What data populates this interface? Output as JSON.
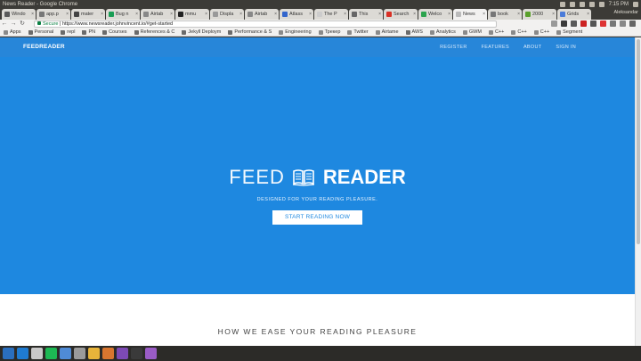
{
  "window": {
    "title": "News Reader - Google Chrome",
    "clock": "7:15 PM",
    "profile": "Aleksandar"
  },
  "tabs": [
    {
      "label": "Windo",
      "color": "#5a5a5a"
    },
    {
      "label": "app.p",
      "color": "#777777"
    },
    {
      "label": "mater",
      "color": "#444444"
    },
    {
      "label": "Bug n",
      "color": "#1a9e55"
    },
    {
      "label": "Airtab",
      "color": "#888888"
    },
    {
      "label": "mmu",
      "color": "#222222"
    },
    {
      "label": "Displa",
      "color": "#999999"
    },
    {
      "label": "Airtab",
      "color": "#888888"
    },
    {
      "label": "Atlass",
      "color": "#3366cc"
    },
    {
      "label": "The P",
      "color": "#cccccc"
    },
    {
      "label": "This",
      "color": "#666666"
    },
    {
      "label": "Search",
      "color": "#d93025"
    },
    {
      "label": "Welco",
      "color": "#2da44e"
    },
    {
      "label": "News",
      "color": "#bbbbbb",
      "active": true
    },
    {
      "label": "book",
      "color": "#777777"
    },
    {
      "label": "2000",
      "color": "#5aa02c"
    },
    {
      "label": "Grids",
      "color": "#4a7bd9"
    }
  ],
  "address": {
    "secure_label": "Secure",
    "url": "https://www.newsreader.johnvincent.io/#get-started"
  },
  "bookmarks": [
    {
      "label": "Apps",
      "icon": "apps-grid-icon"
    },
    {
      "label": "Personal",
      "icon": "folder-icon"
    },
    {
      "label": "repl",
      "icon": "folder-icon"
    },
    {
      "label": "PN",
      "icon": "folder-icon"
    },
    {
      "label": "Courses",
      "icon": "folder-icon"
    },
    {
      "label": "References & C",
      "icon": "folder-icon"
    },
    {
      "label": "Jekyll Deploym",
      "icon": "folder-icon"
    },
    {
      "label": "Performance & S",
      "icon": "folder-icon"
    },
    {
      "label": "Engineering",
      "icon": "link-icon"
    },
    {
      "label": "Трекер",
      "icon": "link-icon"
    },
    {
      "label": "Twitter",
      "icon": "twitter-icon"
    },
    {
      "label": "Airtame",
      "icon": "link-icon"
    },
    {
      "label": "AWS",
      "icon": "folder-icon"
    },
    {
      "label": "Analytics",
      "icon": "analytics-icon"
    },
    {
      "label": "GWM",
      "icon": "link-icon"
    },
    {
      "label": "C++",
      "icon": "link-icon"
    },
    {
      "label": "C++",
      "icon": "link-icon"
    },
    {
      "label": "C++",
      "icon": "link-icon"
    },
    {
      "label": "Segment",
      "icon": "link-icon"
    }
  ],
  "site": {
    "brand": "FEEDREADER",
    "nav": [
      "REGISTER",
      "FEATURES",
      "ABOUT",
      "SIGN IN"
    ],
    "logo_light": "FEED",
    "logo_bold": "READER",
    "tagline": "DESIGNED FOR YOUR READING PLEASURE.",
    "cta": "START READING NOW",
    "section_title": "HOW WE EASE YOUR READING PLEASURE"
  },
  "colors": {
    "hero": "#1e88e0",
    "nav": "#2786d9",
    "cta_text": "#1e88e0"
  },
  "taskbar": [
    {
      "icon": "files-icon",
      "color": "#2a6fbf"
    },
    {
      "icon": "vscode-icon",
      "color": "#1f7bd1"
    },
    {
      "icon": "libreoffice-icon",
      "color": "#c9c9c9"
    },
    {
      "icon": "spotify-icon",
      "color": "#1db954"
    },
    {
      "icon": "mail-icon",
      "color": "#4f8bd6"
    },
    {
      "icon": "file-manager-icon",
      "color": "#9b9b9b"
    },
    {
      "icon": "chrome-icon",
      "color": "#e8b43a"
    },
    {
      "icon": "firefox-icon",
      "color": "#d9762f"
    },
    {
      "icon": "viber-icon",
      "color": "#7d4ab5"
    },
    {
      "icon": "terminal-icon",
      "color": "#3a3a3a"
    },
    {
      "icon": "app-icon",
      "color": "#9a5cc6"
    }
  ]
}
